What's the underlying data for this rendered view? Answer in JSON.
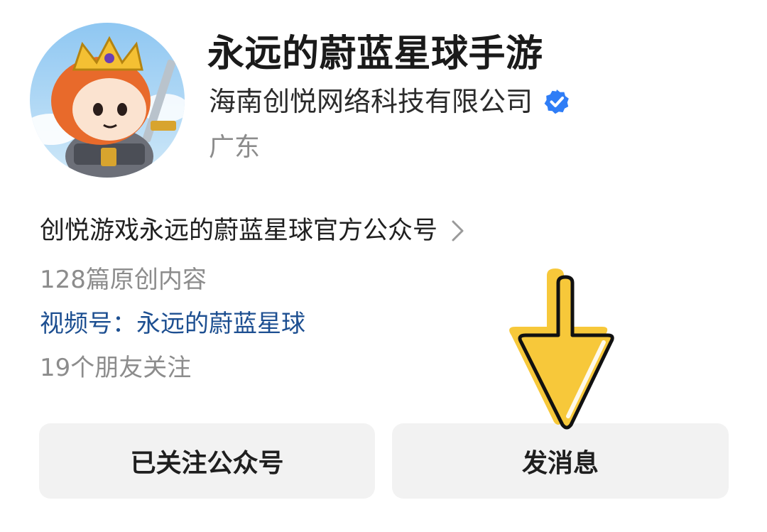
{
  "profile": {
    "account_name": "永远的蔚蓝星球手游",
    "company": "海南创悦网络科技有限公司",
    "location": "广东"
  },
  "info": {
    "intro": "创悦游戏永远的蔚蓝星球官方公众号",
    "article_count": "128篇原创内容",
    "channel": "视频号：永远的蔚蓝星球",
    "friends_follow": "19个朋友关注"
  },
  "actions": {
    "follow_label": "已关注公众号",
    "message_label": "发消息"
  },
  "colors": {
    "verified": "#2f7df6",
    "link": "#1d4f91",
    "arrow_fill": "#f7c83a",
    "button_bg": "#f2f2f2"
  },
  "icons": {
    "verified": "verified-badge-icon",
    "chevron": "chevron-right-icon",
    "annotation": "down-arrow-icon"
  }
}
